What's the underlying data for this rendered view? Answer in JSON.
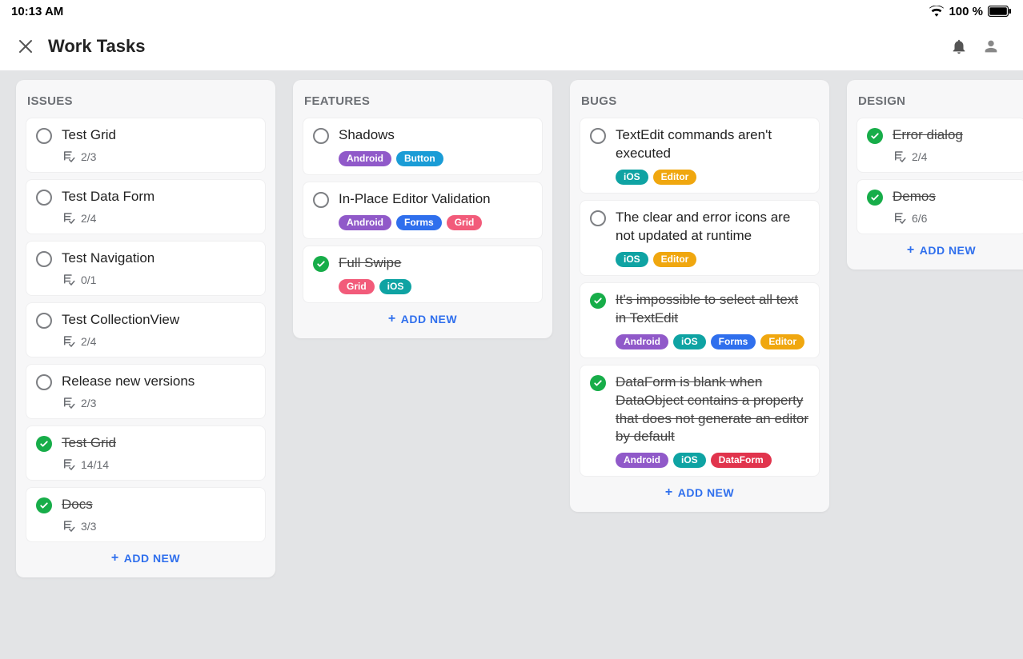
{
  "statusbar": {
    "time": "10:13 AM",
    "battery": "100 %"
  },
  "header": {
    "title": "Work Tasks"
  },
  "labels": {
    "add_new": "ADD NEW"
  },
  "tag_colors": {
    "Android": "#9059c9",
    "Button": "#1a9cd6",
    "Forms": "#2f6fed",
    "Grid": "#f25b7a",
    "iOS": "#0fa3a3",
    "Editor": "#f0a70f",
    "DataForm": "#e1344d"
  },
  "columns": [
    {
      "title": "ISSUES",
      "cards": [
        {
          "title": "Test Grid",
          "done": false,
          "progress": "2/3",
          "tags": []
        },
        {
          "title": "Test Data Form",
          "done": false,
          "progress": "2/4",
          "tags": []
        },
        {
          "title": "Test Navigation",
          "done": false,
          "progress": "0/1",
          "tags": []
        },
        {
          "title": "Test CollectionView",
          "done": false,
          "progress": "2/4",
          "tags": []
        },
        {
          "title": "Release new versions",
          "done": false,
          "progress": "2/3",
          "tags": []
        },
        {
          "title": "Test Grid",
          "done": true,
          "progress": "14/14",
          "tags": []
        },
        {
          "title": "Docs",
          "done": true,
          "progress": "3/3",
          "tags": []
        }
      ]
    },
    {
      "title": "FEATURES",
      "cards": [
        {
          "title": "Shadows",
          "done": false,
          "progress": null,
          "tags": [
            "Android",
            "Button"
          ]
        },
        {
          "title": "In-Place Editor Validation",
          "done": false,
          "progress": null,
          "tags": [
            "Android",
            "Forms",
            "Grid"
          ]
        },
        {
          "title": "Full Swipe",
          "done": true,
          "progress": null,
          "tags": [
            "Grid",
            "iOS"
          ]
        }
      ]
    },
    {
      "title": "BUGS",
      "cards": [
        {
          "title": "TextEdit commands aren't executed",
          "done": false,
          "progress": null,
          "tags": [
            "iOS",
            "Editor"
          ]
        },
        {
          "title": "The clear and error icons are not updated at runtime",
          "done": false,
          "progress": null,
          "tags": [
            "iOS",
            "Editor"
          ]
        },
        {
          "title": "It's impossible to select all text in TextEdit",
          "done": true,
          "progress": null,
          "tags": [
            "Android",
            "iOS",
            "Forms",
            "Editor"
          ]
        },
        {
          "title": "DataForm is blank when DataObject contains a property that does not generate an editor by default",
          "done": true,
          "progress": null,
          "tags": [
            "Android",
            "iOS",
            "DataForm"
          ]
        }
      ]
    },
    {
      "title": "DESIGN",
      "partial": true,
      "cards": [
        {
          "title": "Error dialog",
          "done": true,
          "progress": "2/4",
          "tags": []
        },
        {
          "title": "Demos",
          "done": true,
          "progress": "6/6",
          "tags": []
        }
      ]
    }
  ]
}
